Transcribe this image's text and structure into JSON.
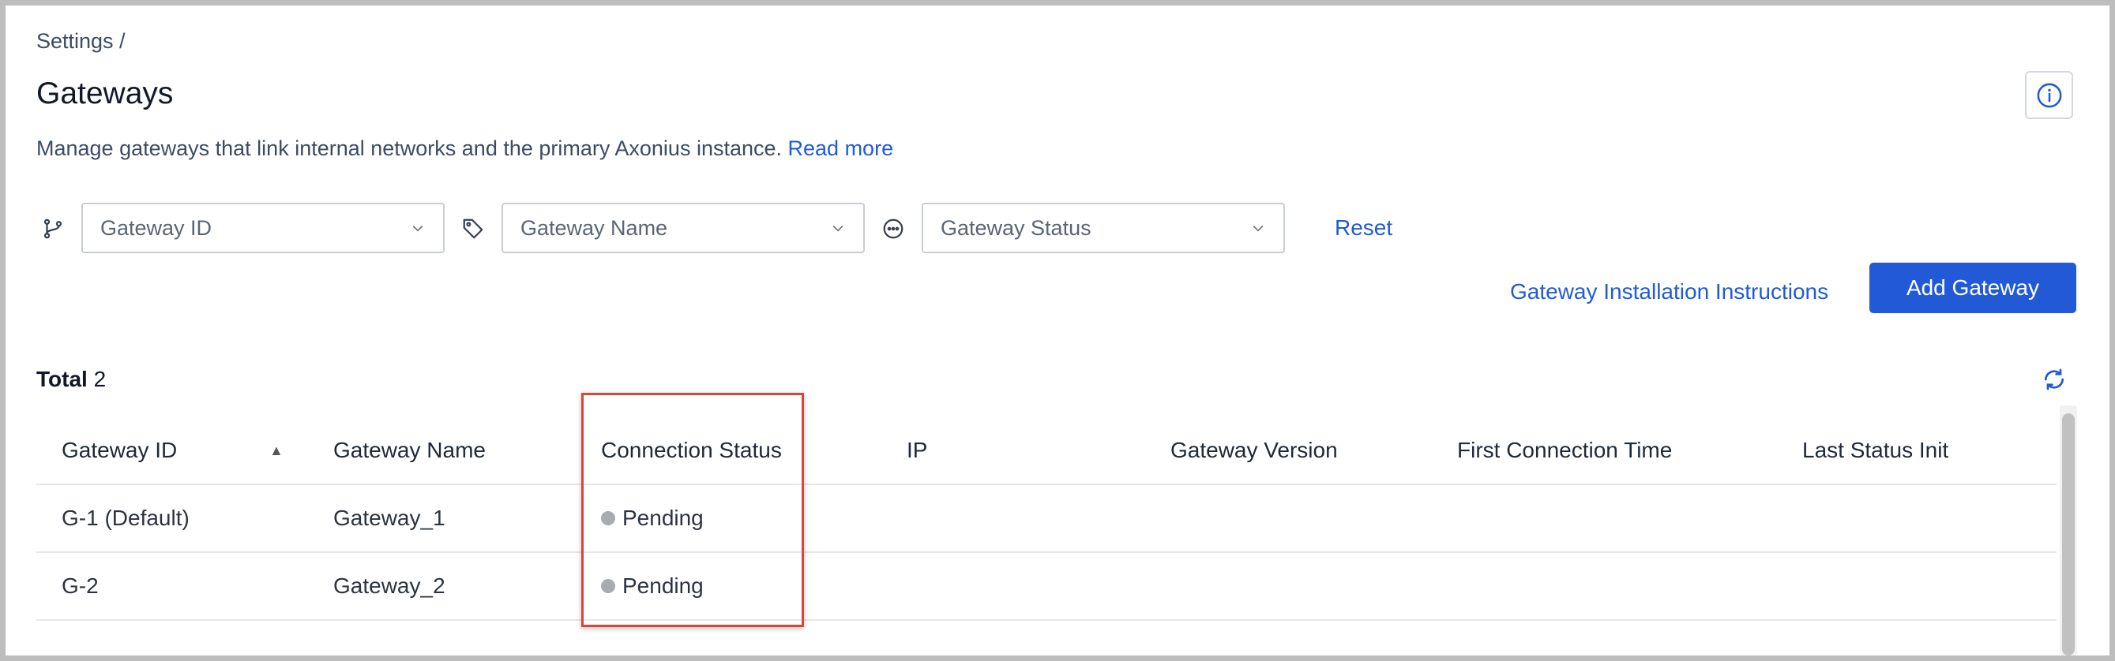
{
  "breadcrumb": "Settings /",
  "title": "Gateways",
  "description": {
    "text": "Manage gateways that link internal networks and the primary Axonius instance. ",
    "link": "Read more"
  },
  "filters": {
    "gateway_id": {
      "placeholder": "Gateway ID",
      "icon": "branch-icon"
    },
    "gateway_name": {
      "placeholder": "Gateway Name",
      "icon": "tag-icon"
    },
    "gateway_status": {
      "placeholder": "Gateway Status",
      "icon": "status-circle-icon"
    },
    "reset_label": "Reset"
  },
  "actions": {
    "install_instructions": "Gateway Installation Instructions",
    "add_gateway": "Add Gateway"
  },
  "total": {
    "label": "Total",
    "count": "2"
  },
  "table": {
    "columns": [
      "Gateway ID",
      "Gateway Name",
      "Connection Status",
      "IP",
      "Gateway Version",
      "First Connection Time",
      "Last Status Init"
    ],
    "sort_indicator": "▲",
    "rows": [
      {
        "id": "G-1 (Default)",
        "name": "Gateway_1",
        "status": "Pending",
        "ip": "",
        "version": "",
        "first_conn": "",
        "last_status": ""
      },
      {
        "id": "G-2",
        "name": "Gateway_2",
        "status": "Pending",
        "ip": "",
        "version": "",
        "first_conn": "",
        "last_status": ""
      }
    ]
  },
  "colors": {
    "accent": "#2159d6",
    "link": "#1f5bd6",
    "highlight_border": "#d9453a",
    "pending_dot": "#a8acb2"
  }
}
